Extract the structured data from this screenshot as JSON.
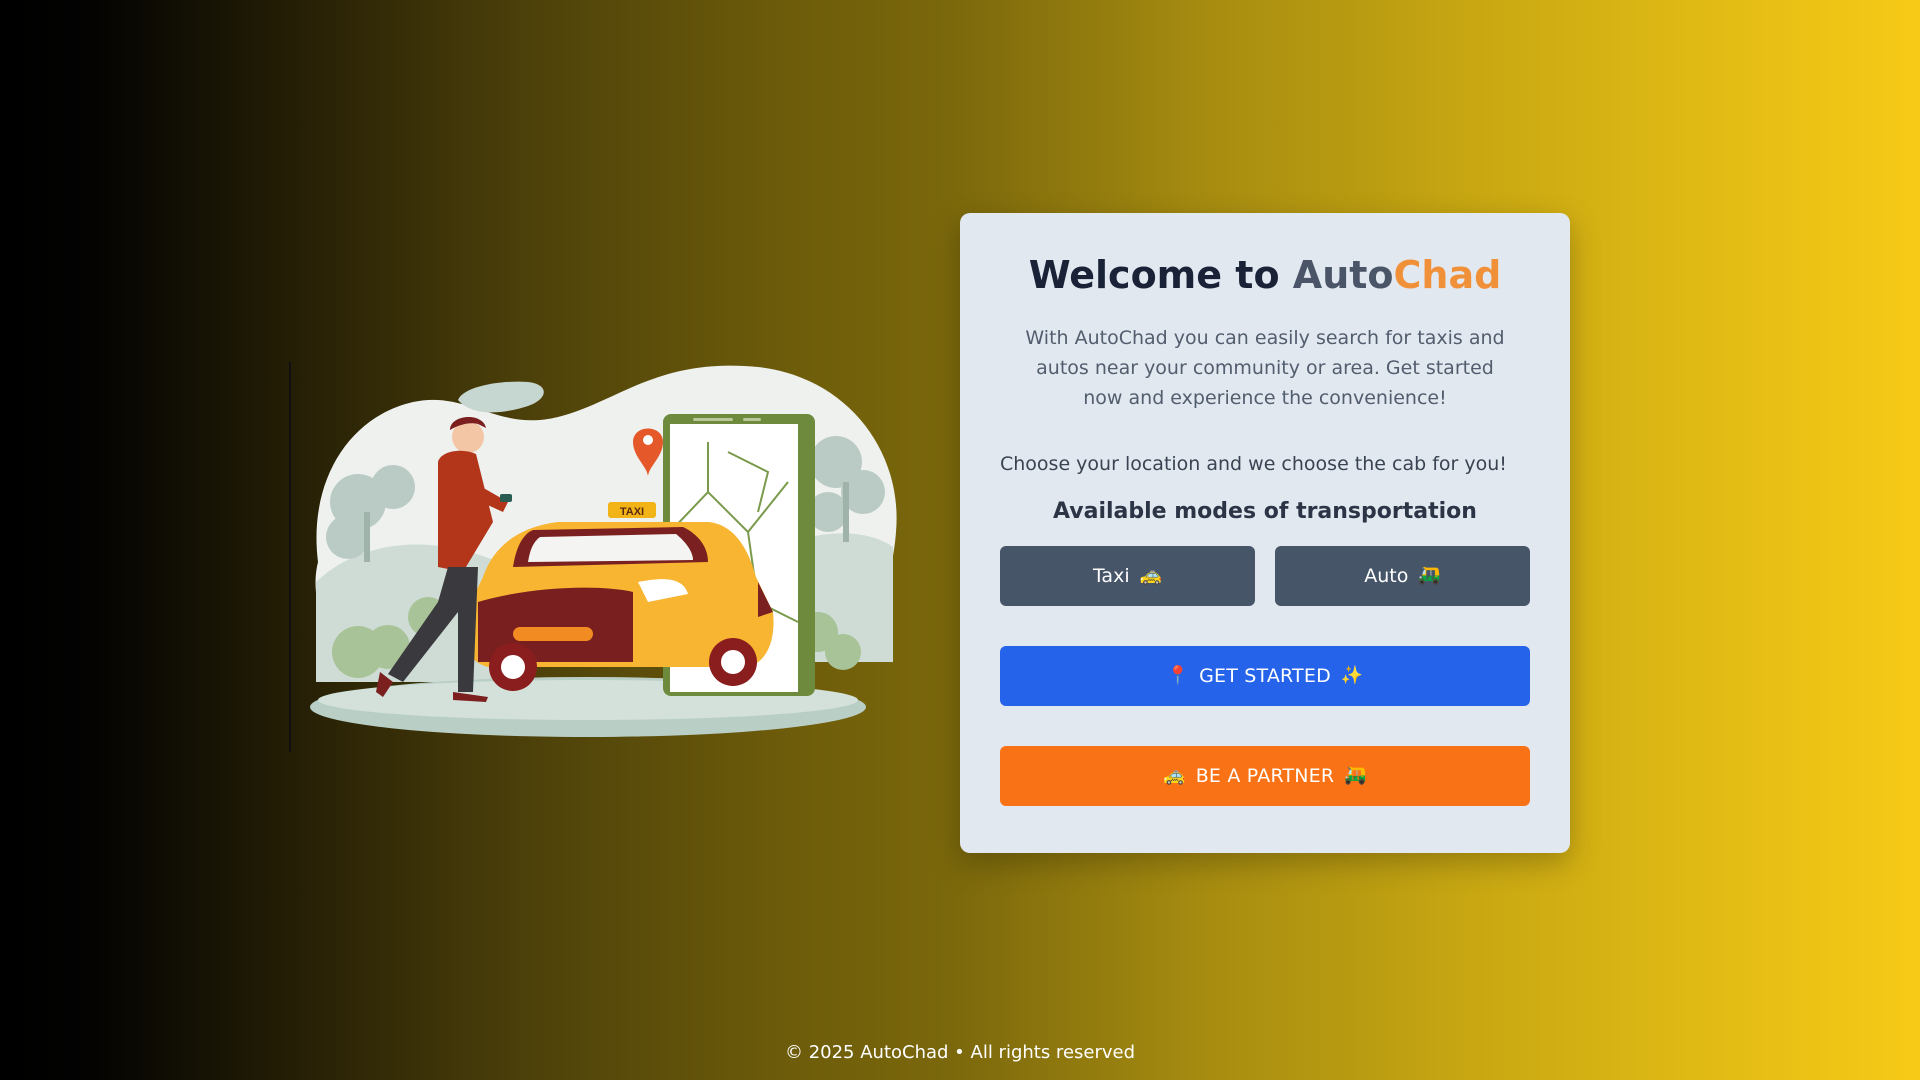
{
  "welcome": {
    "prefix": "Welcome to ",
    "brand_part1": "Auto",
    "brand_part2": "Chad"
  },
  "intro_text": "With AutoChad you can easily search for taxis and autos near your community or area. Get started now and experience the convenience!",
  "choose_text": "Choose your location and we choose the cab for you!",
  "modes": {
    "title": "Available modes of transportation",
    "items": [
      {
        "label": "Taxi",
        "icon": "🚕"
      },
      {
        "label": "Auto",
        "icon": "🛺"
      }
    ]
  },
  "actions": {
    "get_started": {
      "icon_left": "📍",
      "label": "GET STARTED",
      "icon_right": "✨"
    },
    "partner": {
      "icon_left": "🚕",
      "label": "BE A PARTNER",
      "icon_right": "🛺"
    }
  },
  "illustration": {
    "taxi_sign": "TAXI"
  },
  "footer": "© 2025 AutoChad • All rights reserved",
  "colors": {
    "brand_auto": "#4a5568",
    "brand_chad": "#f0913a",
    "mode_button": "#475569",
    "get_started": "#2563eb",
    "partner": "#f97316",
    "card": "#e2e8f0"
  }
}
